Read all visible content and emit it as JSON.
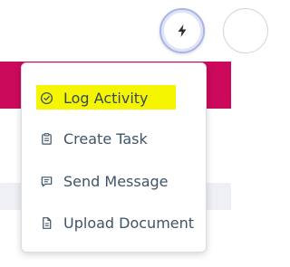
{
  "header": {
    "quick_action_icon": "lightning-bolt-icon"
  },
  "colors": {
    "brand_band": "#cc0a5c",
    "highlight": "#f5f500",
    "menu_text": "#3e5468"
  },
  "quick_actions_menu": {
    "items": [
      {
        "label": "Log Activity",
        "icon": "check-circle-icon",
        "highlighted": true
      },
      {
        "label": "Create Task",
        "icon": "clipboard-icon",
        "highlighted": false
      },
      {
        "label": "Send Message",
        "icon": "chat-bubble-icon",
        "highlighted": false
      },
      {
        "label": "Upload Document",
        "icon": "document-icon",
        "highlighted": false
      }
    ]
  }
}
